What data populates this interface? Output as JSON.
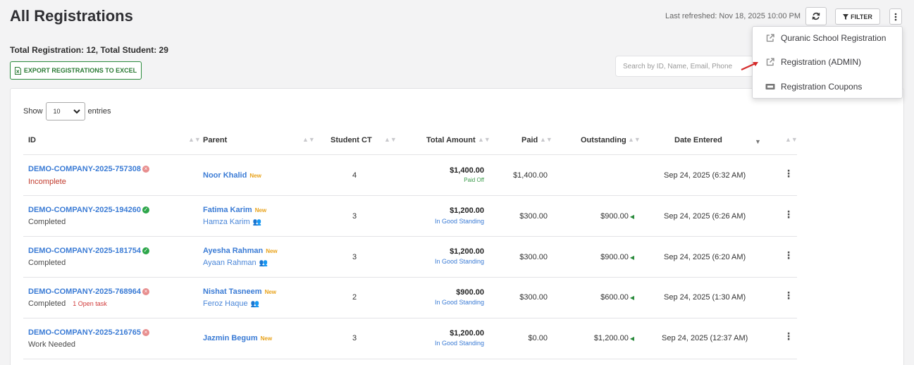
{
  "header": {
    "title": "All Registrations",
    "last_refreshed": "Last refreshed: Nov 18, 2025 10:00 PM",
    "filter_label": "FILTER"
  },
  "summary": {
    "totals": "Total Registration: 12, Total Student: 29",
    "export_label": "EXPORT REGISTRATIONS TO EXCEL"
  },
  "search": {
    "placeholder": "Search by ID, Name, Email, Phone"
  },
  "table_controls": {
    "show": "Show",
    "entries_value": "10",
    "entries": "entries"
  },
  "columns": [
    "ID",
    "Parent",
    "Student CT",
    "Total Amount",
    "Paid",
    "Outstanding",
    "Date Entered"
  ],
  "rows": [
    {
      "id": "DEMO-COMPANY-2025-757308",
      "status": "Incomplete",
      "task": "",
      "parent": "Noor Khalid",
      "child": "",
      "student_ct": "4",
      "total": "$1,400.00",
      "total_note": "Paid Off",
      "paid": "$1,400.00",
      "outstanding": "",
      "date": "Sep 24, 2025 (6:32 AM)"
    },
    {
      "id": "DEMO-COMPANY-2025-194260",
      "status": "Completed",
      "task": "",
      "parent": "Fatima Karim",
      "child": "Hamza Karim",
      "student_ct": "3",
      "total": "$1,200.00",
      "total_note": "In Good Standing",
      "paid": "$300.00",
      "outstanding": "$900.00",
      "date": "Sep 24, 2025 (6:26 AM)"
    },
    {
      "id": "DEMO-COMPANY-2025-181754",
      "status": "Completed",
      "task": "",
      "parent": "Ayesha Rahman",
      "child": "Ayaan Rahman",
      "student_ct": "3",
      "total": "$1,200.00",
      "total_note": "In Good Standing",
      "paid": "$300.00",
      "outstanding": "$900.00",
      "date": "Sep 24, 2025 (6:20 AM)"
    },
    {
      "id": "DEMO-COMPANY-2025-768964",
      "status": "Completed",
      "task": "1 Open task",
      "parent": "Nishat Tasneem",
      "child": "Feroz Haque",
      "student_ct": "2",
      "total": "$900.00",
      "total_note": "In Good Standing",
      "paid": "$300.00",
      "outstanding": "$600.00",
      "date": "Sep 24, 2025 (1:30 AM)"
    },
    {
      "id": "DEMO-COMPANY-2025-216765",
      "status": "Work Needed",
      "task": "",
      "parent": "Jazmin Begum",
      "child": "",
      "student_ct": "3",
      "total": "$1,200.00",
      "total_note": "In Good Standing",
      "paid": "$0.00",
      "outstanding": "$1,200.00",
      "date": "Sep 24, 2025 (12:37 AM)"
    }
  ],
  "badges": {
    "new": "New"
  },
  "menu": {
    "items": [
      {
        "label": "Quranic School Registration",
        "icon": "external-link-icon"
      },
      {
        "label": "Registration (ADMIN)",
        "icon": "external-link-icon"
      },
      {
        "label": "Registration Coupons",
        "icon": "ticket-icon"
      }
    ]
  },
  "colors": {
    "link": "#3a7bd5",
    "export_green": "#2a8a3c",
    "new_badge": "#e8a21a",
    "incomplete_red": "#c0392b",
    "arrow_red": "#d42a2a"
  }
}
